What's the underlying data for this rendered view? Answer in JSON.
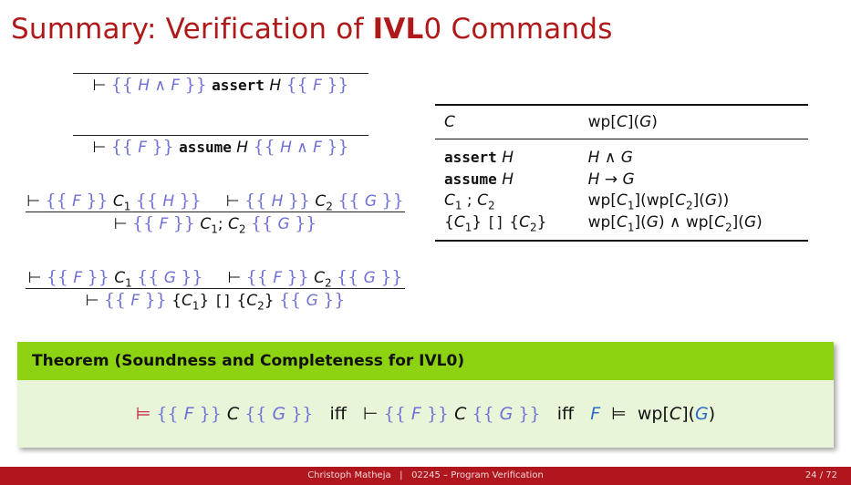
{
  "title": {
    "prefix": "Summary: Verification of ",
    "bold": "IVL",
    "suffix": "0 Commands"
  },
  "rules": {
    "assert": {
      "concl": "⊢ {{ H ∧ F }} assert H {{ F }}"
    },
    "assume": {
      "concl": "⊢ {{ F }} assume H {{ H ∧ F }}"
    },
    "seq": {
      "prem1": "⊢ {{ F }} C1 {{ H }}",
      "prem2": "⊢ {{ H }} C2 {{ G }}",
      "concl": "⊢ {{ F }} C1; C2 {{ G }}"
    },
    "choice": {
      "prem1": "⊢ {{ F }} C1 {{ G }}",
      "prem2": "⊢ {{ F }} C2 {{ G }}",
      "concl": "⊢ {{ F }} {C1} [] {C2} {{ G }}"
    }
  },
  "table": {
    "header": {
      "c": "C",
      "wp": "wp[C](G)"
    },
    "rows": [
      {
        "c": "assert H",
        "wp": "H ∧ G"
      },
      {
        "c": "assume H",
        "wp": "H → G"
      },
      {
        "c": "C1 ; C2",
        "wp": "wp[C1](wp[C2](G))"
      },
      {
        "c": "{C1} [] {C2}",
        "wp": "wp[C1](G) ∧ wp[C2](G)"
      }
    ]
  },
  "theorem": {
    "title": "Theorem (Soundness and Completeness for IVL0)",
    "iff": "iff"
  },
  "footer": {
    "author": "Christoph Matheja",
    "course": "02245 – Program Verification",
    "page": "24 / 72"
  },
  "colors": {
    "title": "#b01919",
    "assertion": "#6f6fd8",
    "theorem_header": "#8ed312",
    "theorem_body": "#e9f5d8",
    "footer": "#b0161e"
  }
}
